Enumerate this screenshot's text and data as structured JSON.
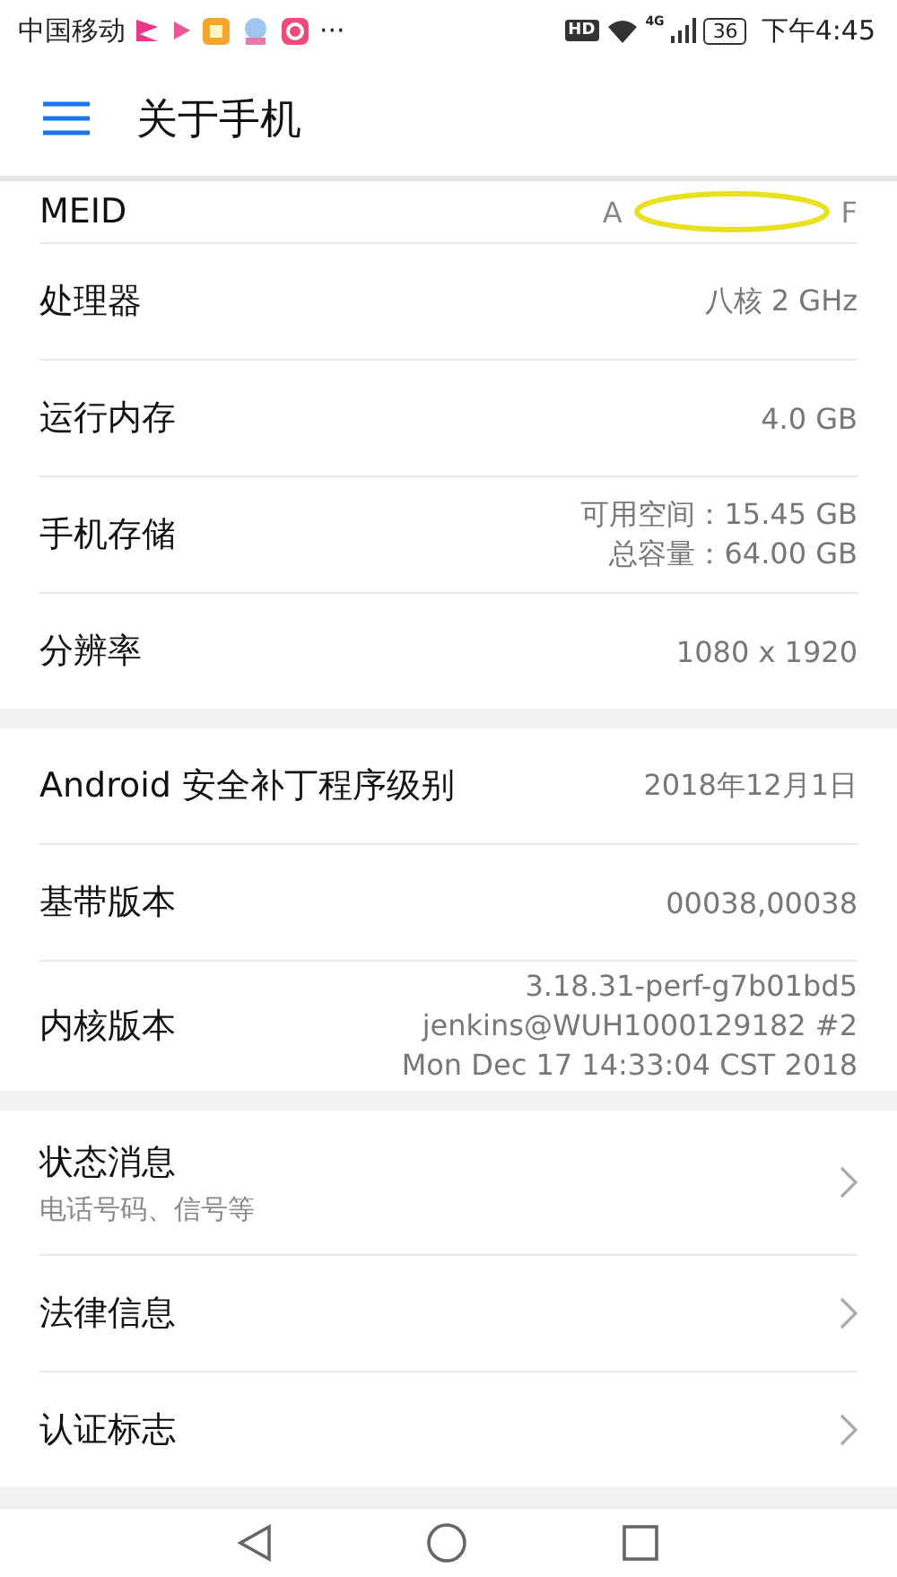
{
  "status_bar": {
    "carrier": "中国移动",
    "more": "···",
    "hd": "HD",
    "network": "4G",
    "battery": "36",
    "time": "下午4:45"
  },
  "app_bar": {
    "title": "关于手机"
  },
  "sections": [
    {
      "rows": [
        {
          "kind": "clipped",
          "label": "MEID",
          "value_start": "A",
          "value_end": "F"
        },
        {
          "kind": "info",
          "label": "处理器",
          "value": "八核 2 GHz"
        },
        {
          "kind": "info",
          "label": "运行内存",
          "value": "4.0 GB"
        },
        {
          "kind": "multi",
          "label": "手机存储",
          "values": [
            "可用空间：15.45  GB",
            "总容量：64.00  GB"
          ]
        },
        {
          "kind": "info",
          "label": "分辨率",
          "value": "1080 x 1920"
        }
      ]
    },
    {
      "rows": [
        {
          "kind": "info",
          "label": "Android 安全补丁程序级别",
          "value": "2018年12月1日"
        },
        {
          "kind": "info",
          "label": "基带版本",
          "value": "00038,00038"
        },
        {
          "kind": "multi",
          "label": "内核版本",
          "values": [
            "3.18.31-perf-g7b01bd5",
            "jenkins@WUH1000129182 #2",
            "Mon Dec 17 14:33:04 CST 2018"
          ]
        }
      ]
    },
    {
      "rows": [
        {
          "kind": "nav",
          "label": "状态消息",
          "sublabel": "电话号码、信号等"
        },
        {
          "kind": "nav",
          "label": "法律信息"
        },
        {
          "kind": "nav",
          "label": "认证标志"
        }
      ]
    }
  ]
}
